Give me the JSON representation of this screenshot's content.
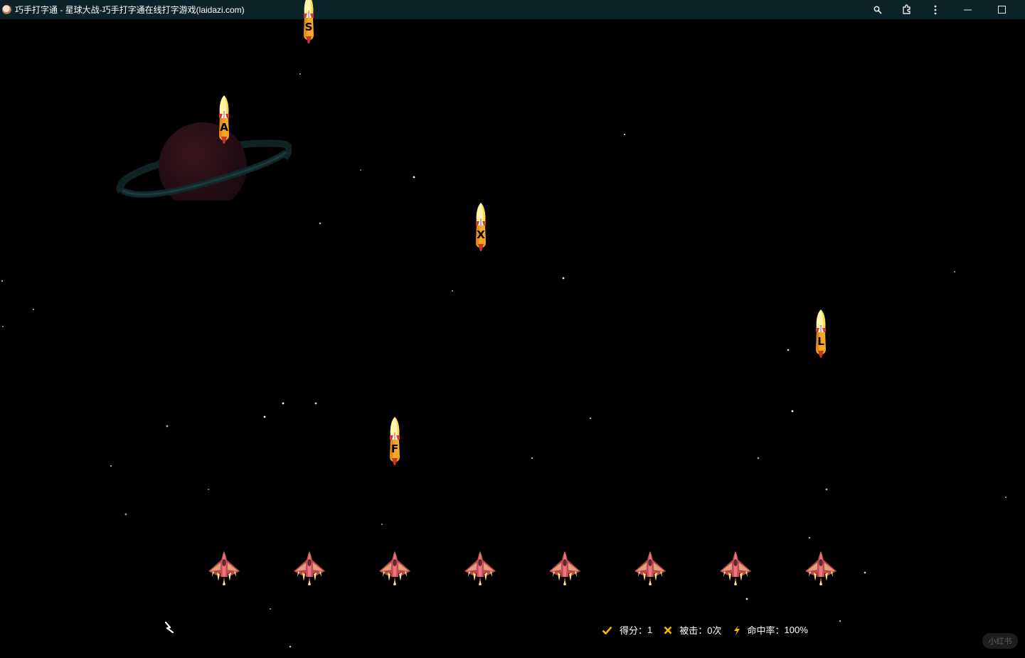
{
  "window": {
    "title": "巧手打字通 - 星球大战-巧手打字通在线打字游戏(laidazi.com)",
    "controls": [
      "zoom-icon",
      "extensions-icon",
      "more-icon",
      "minimize-icon",
      "maximize-icon"
    ]
  },
  "game": {
    "rockets": [
      {
        "letter": "S"
      },
      {
        "letter": "A"
      },
      {
        "letter": "X"
      },
      {
        "letter": "L"
      },
      {
        "letter": "F"
      }
    ],
    "fighter_count": 8,
    "status": {
      "score_label": "得分：",
      "score_value": "1",
      "hit_label": "被击：",
      "hit_value": "0次",
      "accuracy_label": "命中率：",
      "accuracy_value": "100%"
    },
    "watermark": "小红书"
  },
  "colors": {
    "titlebar": "#0b2228",
    "background": "#000000",
    "check": "#f5b800",
    "cross": "#f5b800",
    "bolt": "#f5b800"
  }
}
